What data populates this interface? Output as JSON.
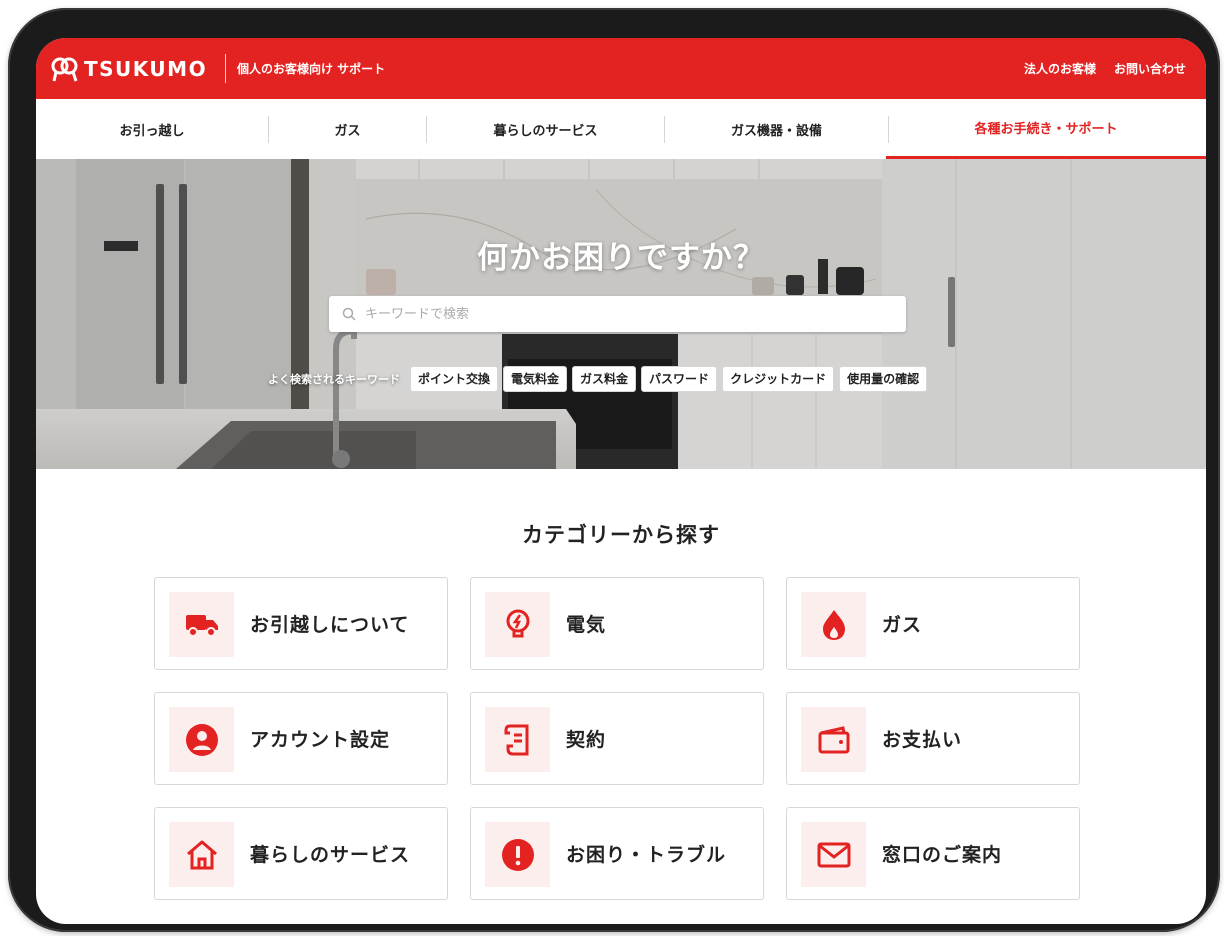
{
  "header": {
    "brand": "TSUKUMO",
    "subtitle": "個人のお客様向け サポート",
    "links": [
      "法人のお客様",
      "お問い合わせ"
    ]
  },
  "nav": {
    "items": [
      "お引っ越し",
      "ガス",
      "暮らしのサービス",
      "ガス機器・設備",
      "各種お手続き・サポート"
    ],
    "active": "各種お手続き・サポート"
  },
  "hero": {
    "title": "何かお困りですか？",
    "search_placeholder": "キーワードで検索",
    "keywords_label": "よく検索されるキーワード",
    "keywords": [
      "ポイント交換",
      "電気料金",
      "ガス料金",
      "パスワード",
      "クレジットカード",
      "使用量の確認"
    ]
  },
  "categories": {
    "title": "カテゴリーから探す",
    "items": [
      {
        "label": "お引越しについて",
        "icon": "truck-icon"
      },
      {
        "label": "電気",
        "icon": "lightbulb-icon"
      },
      {
        "label": "ガス",
        "icon": "flame-icon"
      },
      {
        "label": "アカウント設定",
        "icon": "user-icon"
      },
      {
        "label": "契約",
        "icon": "document-icon"
      },
      {
        "label": "お支払い",
        "icon": "wallet-icon"
      },
      {
        "label": "暮らしのサービス",
        "icon": "home-icon"
      },
      {
        "label": "お困り・トラブル",
        "icon": "alert-icon"
      },
      {
        "label": "窓口のご案内",
        "icon": "mail-icon"
      }
    ]
  },
  "colors": {
    "brand_red": "#e32322",
    "icon_bg": "#fdeeee",
    "card_border": "#d3d8dc"
  }
}
